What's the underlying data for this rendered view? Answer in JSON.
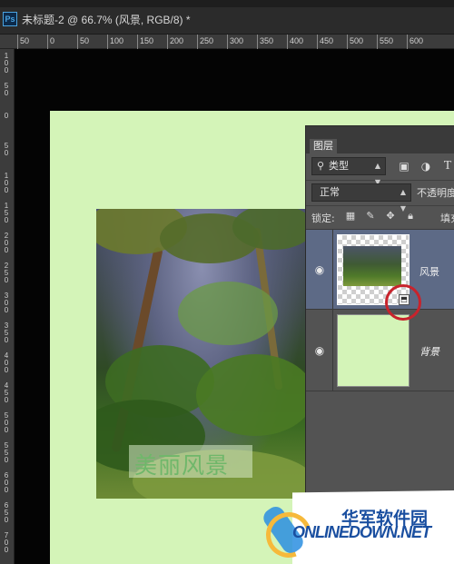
{
  "window": {
    "app_icon": "Ps",
    "doc_title": "未标题-2 @ 66.7% (风景, RGB/8) *"
  },
  "ruler": {
    "top_ticks": [
      "50",
      "0",
      "50",
      "100",
      "150",
      "200",
      "250",
      "300",
      "350",
      "400",
      "450",
      "500",
      "550",
      "600"
    ],
    "left_ticks": [
      "1\n0\n0",
      "5\n0",
      "0",
      "5\n0",
      "1\n0\n0",
      "1\n5\n0",
      "2\n0\n0",
      "2\n5\n0",
      "3\n0\n0",
      "3\n5\n0",
      "4\n0\n0",
      "4\n5\n0",
      "5\n0\n0",
      "5\n5\n0",
      "6\n0\n0",
      "6\n5\n0",
      "7\n0\n0"
    ]
  },
  "canvas": {
    "document_color": "#d4f4b8",
    "watermark_text": "美丽风景"
  },
  "layers_panel": {
    "tab_label": "图层",
    "filter_select": "类型",
    "filter_icons": [
      "image-filter-icon",
      "adjustment-filter-icon",
      "type-filter-icon"
    ],
    "type_filter_glyph": "T",
    "blend_mode": "正常",
    "opacity_label": "不透明度",
    "lock_label": "锁定:",
    "fill_label": "填充",
    "layers": [
      {
        "name": "风景",
        "selected": true,
        "visible": true
      },
      {
        "name": "背景",
        "selected": false,
        "visible": true
      }
    ]
  },
  "site_logo": {
    "cn": "华军软件园",
    "en": "ONLINEDOWN.NET"
  }
}
